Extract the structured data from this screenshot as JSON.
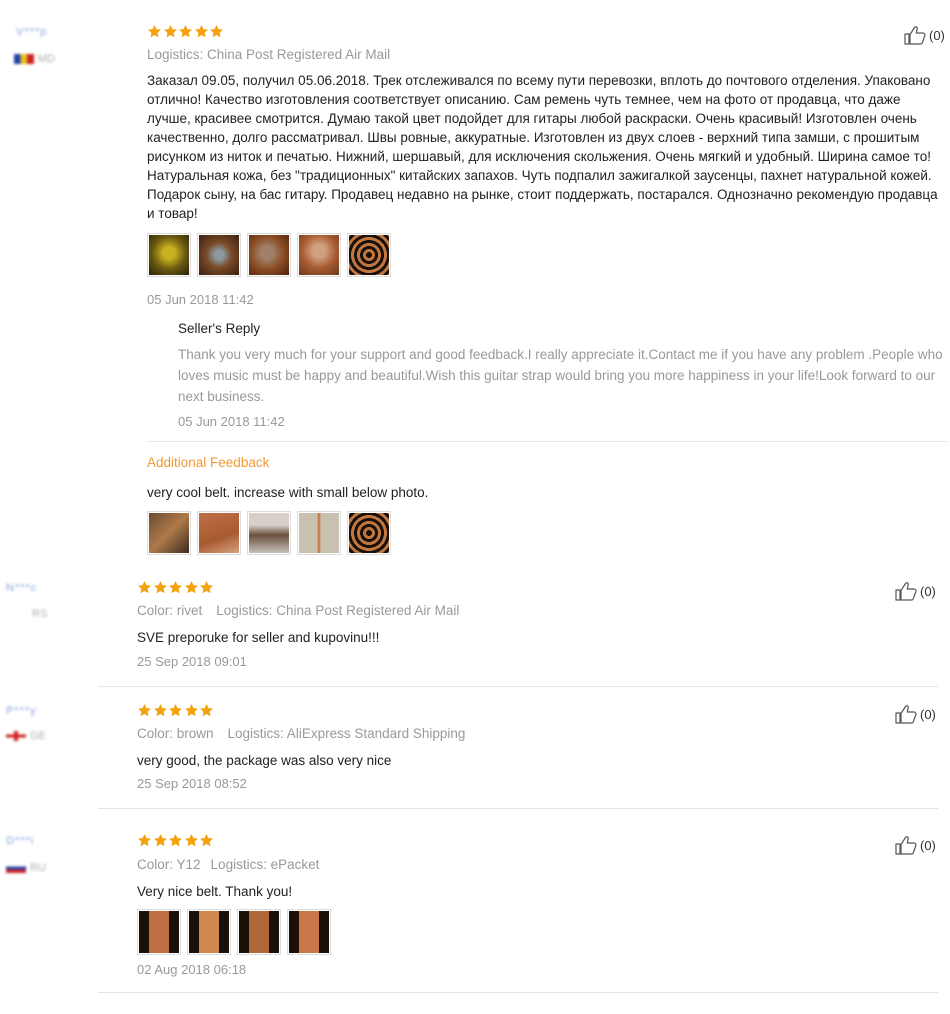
{
  "reviews": [
    {
      "user_name": "V***p",
      "user_country": "MD",
      "logistics": "Logistics: China Post Registered Air Mail",
      "text": "Заказал 09.05, получил 05.06.2018. Трек отслеживался по всему пути перевозки, вплоть до почтового отделения. Упаковано отлично! Качество изготовления соответствует описанию. Сам ремень чуть темнее, чем на фото от продавца, что даже лучше, красивее смотрится. Думаю такой цвет подойдет для гитары любой раскраски. Очень красивый! Изготовлен очень качественно, долго рассматривал. Швы ровные, аккуратные. Изготовлен из двух слоев - верхний типа замши, с прошитым рисунком из ниток и печатью. Нижний, шершавый, для исключения скольжения. Очень мягкий и удобный. Ширина самое то! Натуральная кожа, без \"традиционных\" китайских запахов. Чуть подпалил зажигалкой заусенцы, пахнет натуральной кожей. Подарок сыну, на бас гитару. Продавец недавно на рынке, стоит поддержать, постарался. Однозначно рекомендую продавца и товар!",
      "date": "05 Jun 2018 11:42",
      "likes": "(0)",
      "seller_reply_title": "Seller's Reply",
      "seller_reply_text": "Thank you very much for your support and good feedback.I really appreciate it.Contact me if you have any problem .People who loves music must be happy and beautiful.Wish this guitar strap would bring you more happiness in your life!Look forward to our next business.",
      "seller_reply_date": "05 Jun 2018 11:42",
      "additional_label": "Additional Feedback",
      "additional_text": "very cool belt. increase with small below photo."
    },
    {
      "user_name": "N***c",
      "user_country": "RS",
      "color": "Color: rivet",
      "logistics": "Logistics: China Post Registered Air Mail",
      "text": "SVE preporuke for seller and kupovinu!!!",
      "date": "25 Sep 2018 09:01",
      "likes": "(0)"
    },
    {
      "user_name": "P***y",
      "user_country": "GE",
      "color": "Color: brown",
      "logistics": "Logistics: AliExpress Standard Shipping",
      "text": "very good, the package was also very nice",
      "date": "25 Sep 2018 08:52",
      "likes": "(0)"
    },
    {
      "user_name": "D***i",
      "user_country": "RU",
      "color": "Color: Y12",
      "logistics": "Logistics: ePacket",
      "text": "Very nice belt. Thank you!",
      "date": "02 Aug 2018 06:18",
      "likes": "(0)"
    }
  ],
  "colors": {
    "star": "#f5a20f",
    "additional_feedback": "#f19a35",
    "muted_text": "#999999"
  },
  "icons": [
    "star-icon",
    "thumbs-up-icon"
  ]
}
